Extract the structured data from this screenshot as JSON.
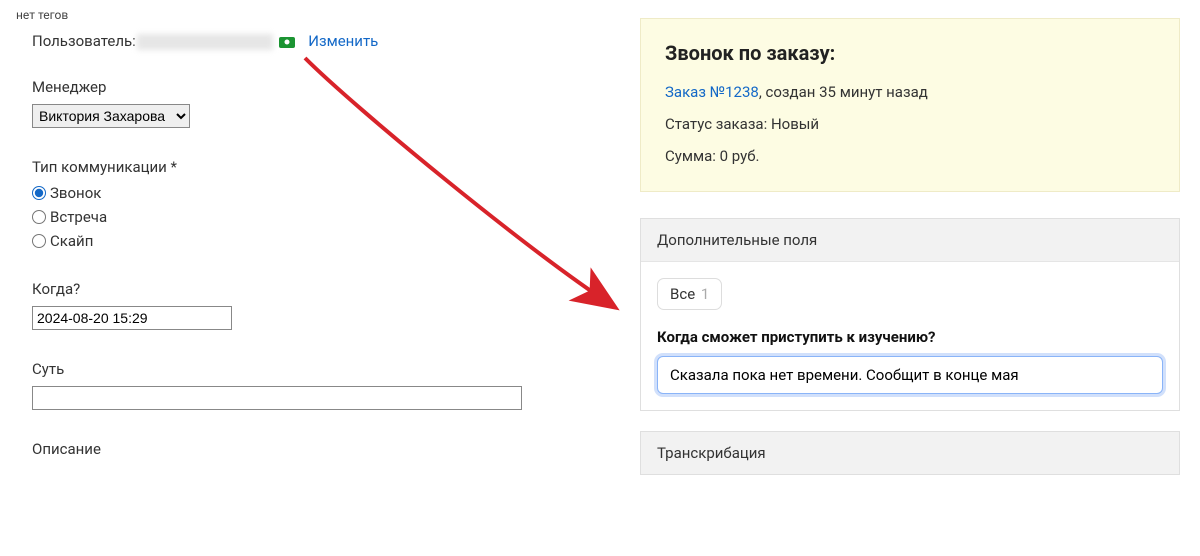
{
  "left": {
    "no_tags": "нет тегов",
    "user_label": "Пользователь:",
    "change_link": "Изменить",
    "manager_label": "Менеджер",
    "manager_value": "Виктория Захарова",
    "comm_type_label": "Тип коммуникации *",
    "comm_options": {
      "call": "Звонок",
      "meeting": "Встреча",
      "skype": "Скайп"
    },
    "when_label": "Когда?",
    "when_value": "2024-08-20 15:29",
    "essence_label": "Суть",
    "essence_value": "",
    "description_label": "Описание"
  },
  "right": {
    "call_card": {
      "title": "Звонок по заказу:",
      "order_link": "Заказ №1238",
      "created_suffix": ", создан 35 минут назад",
      "status_line": "Статус заказа: Новый",
      "amount_line": "Сумма: 0 руб."
    },
    "extra_fields": {
      "header": "Дополнительные поля",
      "chip_label": "Все",
      "chip_count": "1",
      "question": "Когда сможет приступить к изучению?",
      "answer": "Сказала пока нет времени. Сообщит в конце мая"
    },
    "transcription_header": "Транскрибация"
  }
}
